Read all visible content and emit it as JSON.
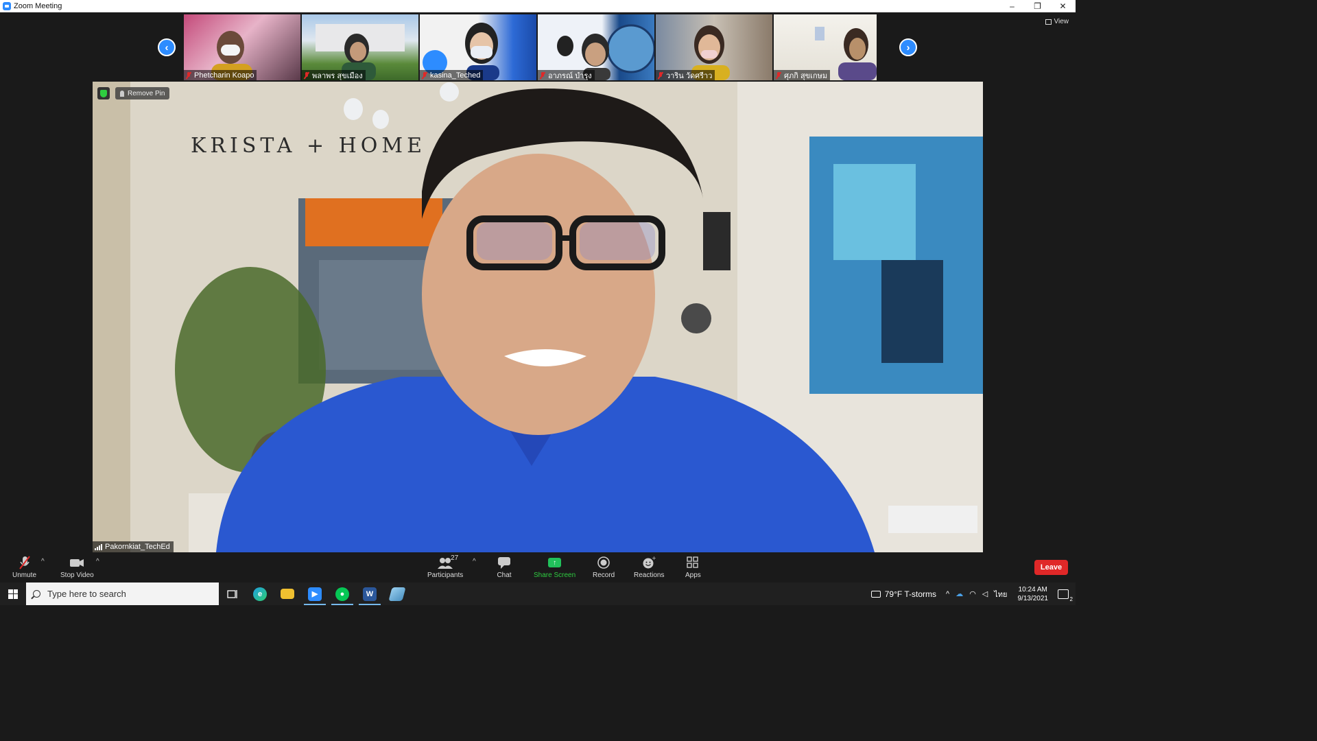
{
  "window": {
    "title": "Zoom Meeting",
    "controls": [
      "–",
      "❐",
      "✕"
    ]
  },
  "gallery": {
    "view_label": "View",
    "participants": [
      {
        "name": "Phetcharin Koapo",
        "muted": true
      },
      {
        "name": "พลาพร สุขเมือง",
        "muted": true
      },
      {
        "name": "kasina_Teched",
        "muted": true
      },
      {
        "name": "อาภรณ์ บำรุง",
        "muted": true
      },
      {
        "name": "วาริน วัดศรีาว",
        "muted": true
      },
      {
        "name": "ศุภกิ สุขเกษม",
        "muted": true
      }
    ]
  },
  "main_video": {
    "speaker_name": "Pakornkiat_TechEd",
    "remove_pin_label": "Remove Pin",
    "wall_text": "KRISTA + HOME"
  },
  "controls": {
    "unmute_label": "Unmute",
    "stop_video_label": "Stop Video",
    "participants_label": "Participants",
    "participants_count": "27",
    "chat_label": "Chat",
    "share_screen_label": "Share Screen",
    "record_label": "Record",
    "reactions_label": "Reactions",
    "apps_label": "Apps",
    "leave_label": "Leave"
  },
  "taskbar": {
    "search_placeholder": "Type here to search",
    "weather_text": "79°F  T-storms",
    "language": "ไทย",
    "time": "10:24 AM",
    "date": "9/13/2021",
    "notification_count": "2"
  },
  "colors": {
    "accent_blue": "#2d8cff",
    "leave_red": "#e02828",
    "share_green": "#21c15b",
    "bar_bg": "#1a1a1a"
  }
}
